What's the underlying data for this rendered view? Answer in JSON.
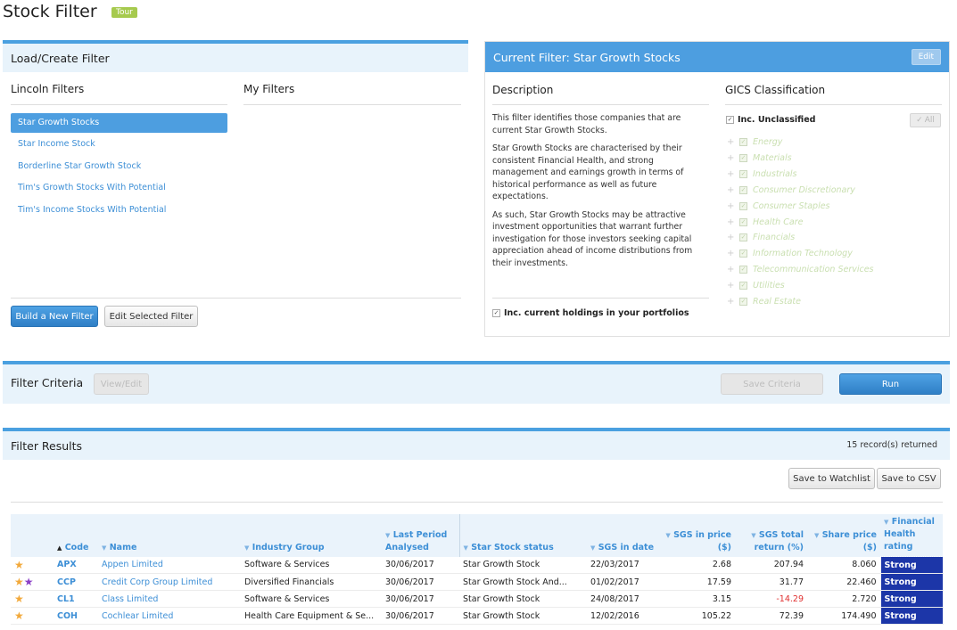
{
  "page": {
    "title": "Stock Filter",
    "tour_label": "Tour"
  },
  "load_panel": {
    "title": "Load/Create Filter",
    "lincoln_title": "Lincoln Filters",
    "my_title": "My Filters",
    "lincoln_filters": [
      {
        "label": "Star Growth Stocks",
        "selected": true
      },
      {
        "label": "Star Income Stock"
      },
      {
        "label": "Borderline Star Growth Stock"
      },
      {
        "label": "Tim's Growth Stocks With Potential"
      },
      {
        "label": "Tim's Income Stocks With Potential"
      }
    ],
    "build_button": "Build a New Filter",
    "edit_button": "Edit Selected Filter"
  },
  "current_filter": {
    "title": "Current Filter: Star Growth Stocks",
    "edit_label": "Edit",
    "description_title": "Description",
    "description": [
      "This filter identifies those companies that are current Star Growth Stocks.",
      "Star Growth Stocks are characterised by their consistent Financial Health, and strong management and earnings growth in terms of historical performance as well as future expectations.",
      "As such, Star Growth Stocks may be attractive investment opportunities that warrant further investigation for those investors seeking capital appreciation ahead of income distributions from their investments."
    ],
    "holdings_label": "Inc. current holdings in your portfolios",
    "gics_title": "GICS Classification",
    "unclassified_label": "Inc. Unclassified",
    "all_label": "All",
    "gics": [
      "Energy",
      "Materials",
      "Industrials",
      "Consumer Discretionary",
      "Consumer Staples",
      "Health Care",
      "Financials",
      "Information Technology",
      "Telecommunication Services",
      "Utilities",
      "Real Estate"
    ]
  },
  "criteria": {
    "title": "Filter Criteria",
    "view_edit": "View/Edit",
    "save_criteria": "Save Criteria",
    "run": "Run"
  },
  "results": {
    "title": "Filter Results",
    "count_text": "15 record(s) returned",
    "save_watchlist": "Save to Watchlist",
    "save_csv": "Save to CSV",
    "headers": {
      "code": "Code",
      "name": "Name",
      "industry": "Industry Group",
      "last_period_1": "Last Period",
      "last_period_2": "Analysed",
      "status": "Star Stock status",
      "sgs_date": "SGS in date",
      "sgs_price_1": "SGS in price",
      "sgs_price_2": "($)",
      "sgs_return_1": "SGS total",
      "sgs_return_2": "return (%)",
      "share_price_1": "Share price",
      "share_price_2": "($)",
      "fin_1": "Financial",
      "fin_2": "Health rating"
    },
    "rows": [
      {
        "stars": [
          "gold"
        ],
        "code": "APX",
        "name": "Appen Limited",
        "industry": "Software & Services",
        "last_period": "30/06/2017",
        "status": "Star Growth Stock",
        "sgs_date": "22/03/2017",
        "sgs_price": "2.68",
        "sgs_return": "207.94",
        "share_price": "8.060",
        "rating": "Strong"
      },
      {
        "stars": [
          "gold",
          "purple"
        ],
        "code": "CCP",
        "name": "Credit Corp Group Limited",
        "industry": "Diversified Financials",
        "last_period": "30/06/2017",
        "status": "Star Growth Stock And...",
        "sgs_date": "01/02/2017",
        "sgs_price": "17.59",
        "sgs_return": "31.77",
        "share_price": "22.460",
        "rating": "Strong"
      },
      {
        "stars": [
          "gold"
        ],
        "code": "CL1",
        "name": "Class Limited",
        "industry": "Software & Services",
        "last_period": "30/06/2017",
        "status": "Star Growth Stock",
        "sgs_date": "24/08/2017",
        "sgs_price": "3.15",
        "sgs_return": "-14.29",
        "negative": true,
        "share_price": "2.720",
        "rating": "Strong"
      },
      {
        "stars": [
          "gold"
        ],
        "code": "COH",
        "name": "Cochlear Limited",
        "industry": "Health Care Equipment & Se...",
        "last_period": "30/06/2017",
        "status": "Star Growth Stock",
        "sgs_date": "12/02/2016",
        "sgs_price": "105.22",
        "sgs_return": "72.39",
        "share_price": "174.490",
        "rating": "Strong"
      }
    ]
  },
  "colors": {
    "accent": "#4d9ee0",
    "rating_bg": "#1c36a8",
    "negative": "#e03030",
    "star_gold": "#f2a93b",
    "star_purple": "#8b3fc6"
  }
}
